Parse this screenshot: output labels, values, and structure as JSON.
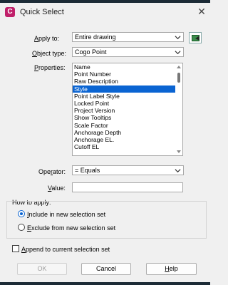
{
  "window": {
    "title": "Quick Select",
    "app_icon_letter": "C",
    "close_symbol": "✕"
  },
  "form": {
    "apply_to": {
      "label_pre": "",
      "label_accel": "A",
      "label_post": "pply to:",
      "value": "Entire drawing"
    },
    "object_type": {
      "label_pre": "",
      "label_accel": "O",
      "label_post": "bject type:",
      "value": "Cogo Point"
    },
    "properties": {
      "label_pre": "",
      "label_accel": "P",
      "label_post": "roperties:",
      "items": [
        "Name",
        "Point Number",
        "Raw Description",
        "Style",
        "Point Label Style",
        "Locked Point",
        "Project Version",
        "Show Tooltips",
        "Scale Factor",
        "Anchorage Depth",
        "Anchorage EL.",
        "Cutoff EL"
      ],
      "selected_index": 3
    },
    "operator": {
      "label_pre": "Ope",
      "label_accel": "r",
      "label_post": "ator:",
      "value": "= Equals"
    },
    "value": {
      "label_pre": "",
      "label_accel": "V",
      "label_post": "alue:",
      "current": ""
    }
  },
  "how_to_apply": {
    "legend": "How to apply:",
    "options": [
      {
        "pre": "",
        "accel": "I",
        "post": "nclude in new selection set",
        "selected": true
      },
      {
        "pre": "",
        "accel": "E",
        "post": "xclude from new selection set",
        "selected": false
      }
    ]
  },
  "append": {
    "pre": "",
    "accel": "A",
    "post": "ppend to current selection set",
    "checked": false
  },
  "buttons": {
    "ok": "OK",
    "cancel": "Cancel",
    "help_pre": "",
    "help_accel": "H",
    "help_post": "elp"
  },
  "colors": {
    "selection": "#0a64d2",
    "app_icon": "#c0206a",
    "select_objects_icon": "#3c8c4c"
  },
  "icons": [
    "app-icon",
    "close-icon",
    "chevron-down-icon",
    "select-objects-icon"
  ]
}
